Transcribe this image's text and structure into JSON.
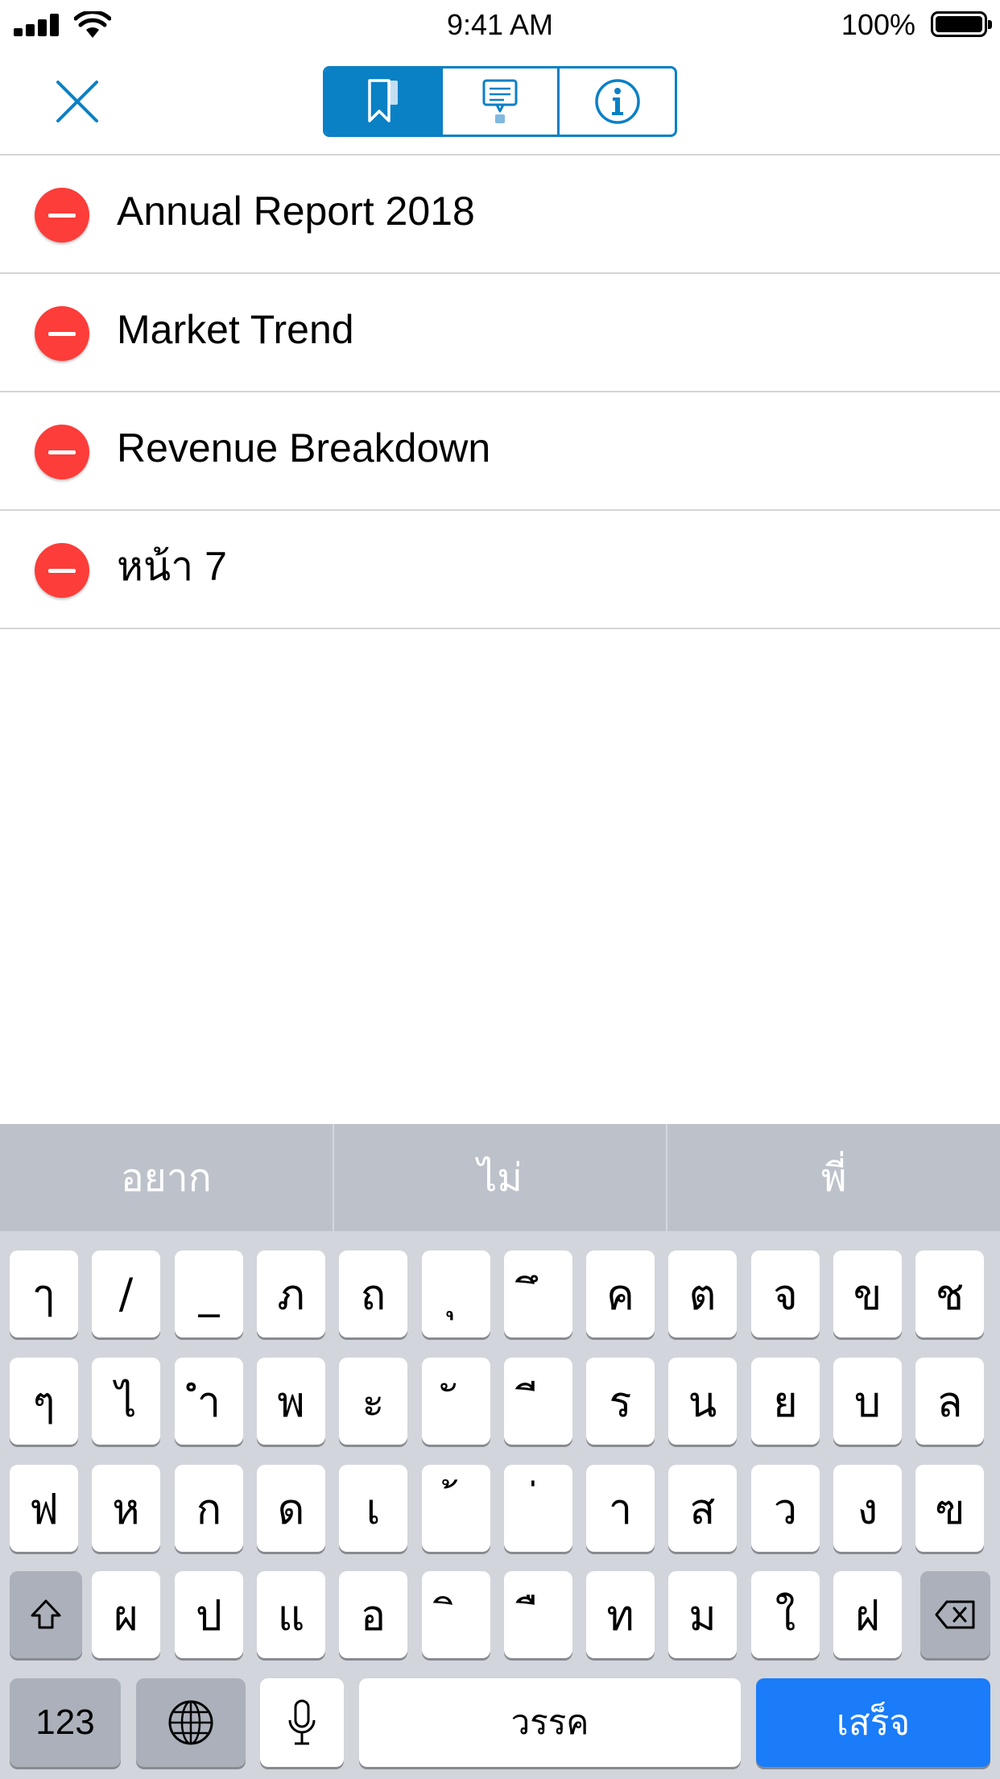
{
  "status_bar": {
    "time": "9:41 AM",
    "battery": "100%"
  },
  "nav": {
    "tabs": [
      {
        "icon": "bookmark-icon",
        "active": true
      },
      {
        "icon": "annotation-icon",
        "active": false
      },
      {
        "icon": "info-icon",
        "active": false
      }
    ],
    "accent_color": "#0a80c5"
  },
  "bookmarks": [
    {
      "title": "Annual Report 2018"
    },
    {
      "title": "Market Trend"
    },
    {
      "title": "Revenue Breakdown"
    },
    {
      "title": "หน้า 7"
    }
  ],
  "keyboard": {
    "predictions": [
      "อยาก",
      "ไม่",
      "พี่"
    ],
    "rows": [
      [
        "ๅ",
        "/",
        "_",
        "ภ",
        "ถ",
        "ุ",
        "ึ",
        "ค",
        "ต",
        "จ",
        "ข",
        "ช"
      ],
      [
        "ๆ",
        "ไ",
        "ำ",
        "พ",
        "ะ",
        "ั",
        "ี",
        "ร",
        "น",
        "ย",
        "บ",
        "ล"
      ],
      [
        "ฟ",
        "ห",
        "ก",
        "ด",
        "เ",
        "้",
        "่",
        "า",
        "ส",
        "ว",
        "ง",
        "ฃ"
      ],
      [
        "ผ",
        "ป",
        "แ",
        "อ",
        "ิ",
        "ื",
        "ท",
        "ม",
        "ใ",
        "ฝ"
      ]
    ],
    "numbers_label": "123",
    "space_label": "วรรค",
    "done_label": "เสร็จ",
    "done_color": "#1a7cf9"
  }
}
